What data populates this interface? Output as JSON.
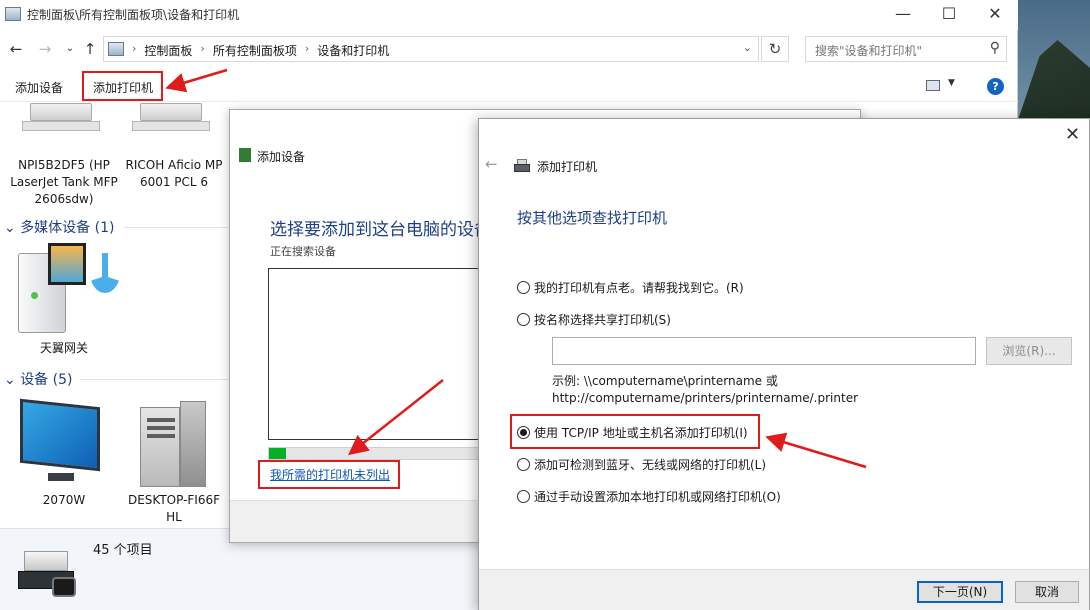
{
  "explorer": {
    "title": "控制面板\\所有控制面板项\\设备和打印机",
    "breadcrumbs": [
      "控制面板",
      "所有控制面板项",
      "设备和打印机"
    ],
    "search_placeholder": "搜索\"设备和打印机\"",
    "toolbar": {
      "add_device": "添加设备",
      "add_printer": "添加打印机",
      "help": "?"
    },
    "printers": [
      {
        "name": "NPI5B2DF5 (HP LaserJet Tank MFP 2606sdw)"
      },
      {
        "name": "RICOH Aficio MP 6001 PCL 6"
      }
    ],
    "groups": {
      "multimedia": "多媒体设备 (1)",
      "devices": "设备 (5)"
    },
    "multimedia_items": [
      {
        "name": "天翼网关"
      }
    ],
    "device_items": [
      {
        "name": "2070W"
      },
      {
        "name": "DESKTOP-FI66FHL"
      }
    ],
    "status_count": "45 个项目"
  },
  "add_device_dialog": {
    "title": "添加设备",
    "heading": "选择要添加到这台电脑的设备",
    "searching": "正在搜索设备",
    "progress": 0.08,
    "not_listed_link": "我所需的打印机未列出"
  },
  "add_printer_dialog": {
    "title": "添加打印机",
    "heading": "按其他选项查找打印机",
    "options": [
      "我的打印机有点老。请帮我找到它。(R)",
      "按名称选择共享打印机(S)",
      "使用 TCP/IP 地址或主机名添加打印机(I)",
      "添加可检测到蓝牙、无线或网络的打印机(L)",
      "通过手动设置添加本地打印机或网络打印机(O)"
    ],
    "selected_option": 2,
    "browse_button": "浏览(R)...",
    "example_line1": "示例: \\\\computername\\printername 或",
    "example_line2": "http://computername/printers/printername/.printer",
    "next_button": "下一页(N)",
    "cancel_button": "取消"
  },
  "colors": {
    "annotation_red": "#e01b1b",
    "link_blue": "#0b58b8",
    "heading_blue": "#1e3f87"
  }
}
